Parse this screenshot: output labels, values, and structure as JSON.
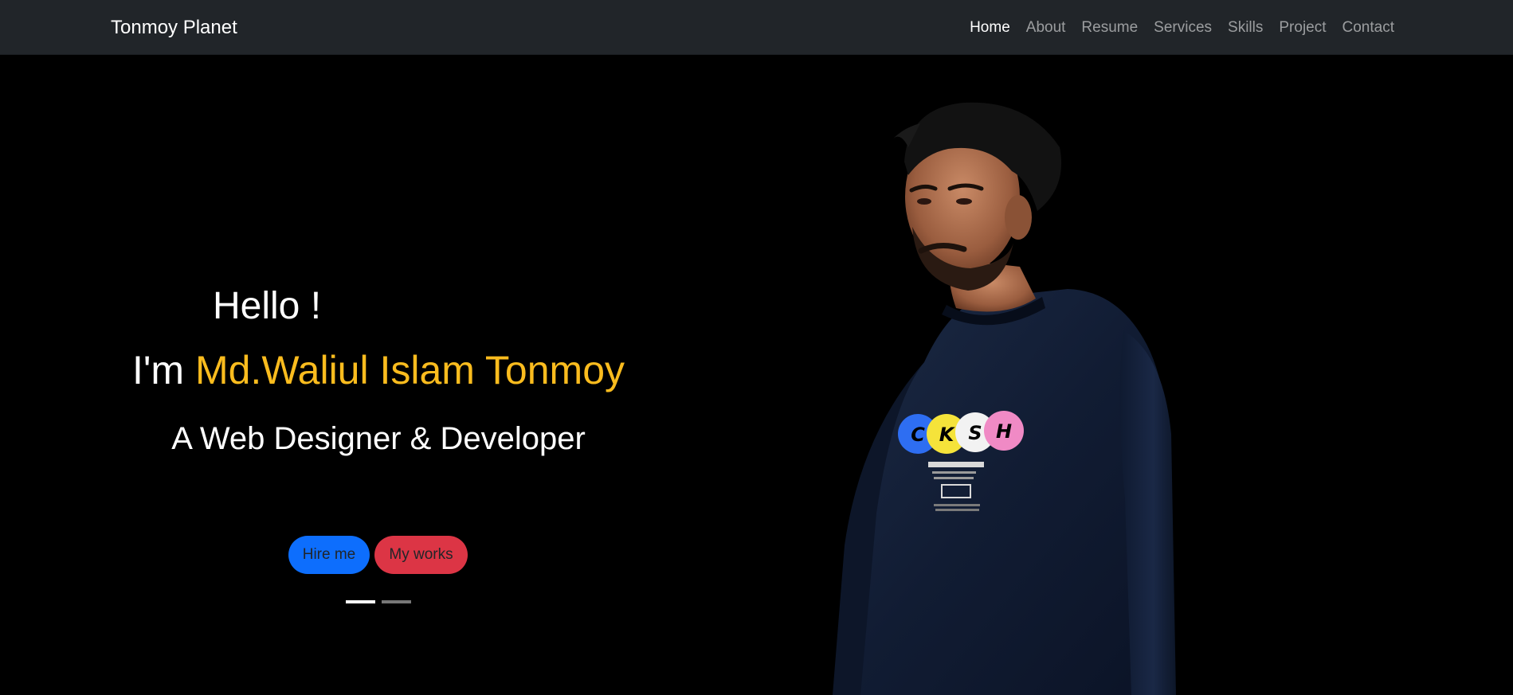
{
  "navbar": {
    "brand": "Tonmoy Planet",
    "links": [
      {
        "label": "Home",
        "active": true
      },
      {
        "label": "About",
        "active": false
      },
      {
        "label": "Resume",
        "active": false
      },
      {
        "label": "Services",
        "active": false
      },
      {
        "label": "Skills",
        "active": false
      },
      {
        "label": "Project",
        "active": false
      },
      {
        "label": "Contact",
        "active": false
      }
    ]
  },
  "hero": {
    "greeting": "Hello !",
    "intro_prefix": "I'm ",
    "name": "Md.Waliul Islam Tonmoy",
    "role": "A Web Designer & Developer",
    "buttons": {
      "hire_label": "Hire me",
      "works_label": "My works"
    },
    "carousel": {
      "slide_count": 2,
      "active_index": 0
    },
    "shirt_print": [
      "C",
      "K",
      "S",
      "H"
    ]
  },
  "colors": {
    "navbar_bg": "#212529",
    "hero_bg": "#000000",
    "name_accent": "#fbbc1e",
    "hire_button": "#0d6efd",
    "works_button": "#dc3545"
  }
}
